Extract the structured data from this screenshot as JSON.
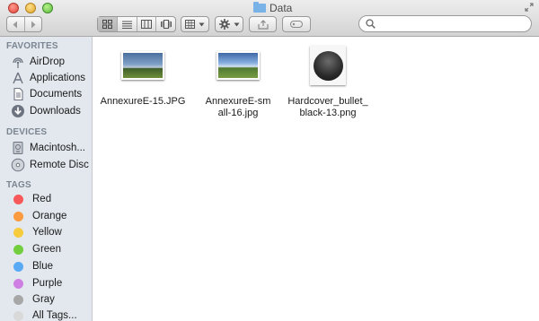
{
  "window": {
    "title": "Data"
  },
  "toolbar": {
    "back_icon": "chevron-left-icon",
    "forward_icon": "chevron-right-icon",
    "view_modes": [
      "icon-view-icon",
      "list-view-icon",
      "column-view-icon",
      "cover-flow-icon"
    ],
    "active_view": "icon-view-icon",
    "arrange_icon": "arrange-grid-icon",
    "action_icon": "gear-icon",
    "share_icon": "share-icon",
    "tags_icon": "tag-icon"
  },
  "search": {
    "value": "",
    "placeholder": ""
  },
  "sidebar": {
    "favorites_title": "FAVORITES",
    "favorites": [
      {
        "label": "AirDrop",
        "icon": "airdrop-icon"
      },
      {
        "label": "Applications",
        "icon": "applications-icon"
      },
      {
        "label": "Documents",
        "icon": "documents-icon"
      },
      {
        "label": "Downloads",
        "icon": "downloads-icon"
      }
    ],
    "devices_title": "DEVICES",
    "devices": [
      {
        "label": "Macintosh...",
        "icon": "hard-drive-icon"
      },
      {
        "label": "Remote Disc",
        "icon": "remote-disc-icon"
      }
    ],
    "tags_title": "TAGS",
    "tags": [
      {
        "label": "Red",
        "color": "#f7585a"
      },
      {
        "label": "Orange",
        "color": "#fb9a3e"
      },
      {
        "label": "Yellow",
        "color": "#f6cb3c"
      },
      {
        "label": "Green",
        "color": "#72ce3f"
      },
      {
        "label": "Blue",
        "color": "#58aaf4"
      },
      {
        "label": "Purple",
        "color": "#cf7fe4"
      },
      {
        "label": "Gray",
        "color": "#a7a7a7"
      },
      {
        "label": "All Tags...",
        "color": "#d9d9d9"
      }
    ]
  },
  "files": [
    {
      "name": "AnnexureE-15.JPG",
      "kind": "photo"
    },
    {
      "name": "AnnexureE-small-16.jpg",
      "kind": "photo"
    },
    {
      "name": "Hardcover_bullet_black-13.png",
      "kind": "image"
    }
  ]
}
